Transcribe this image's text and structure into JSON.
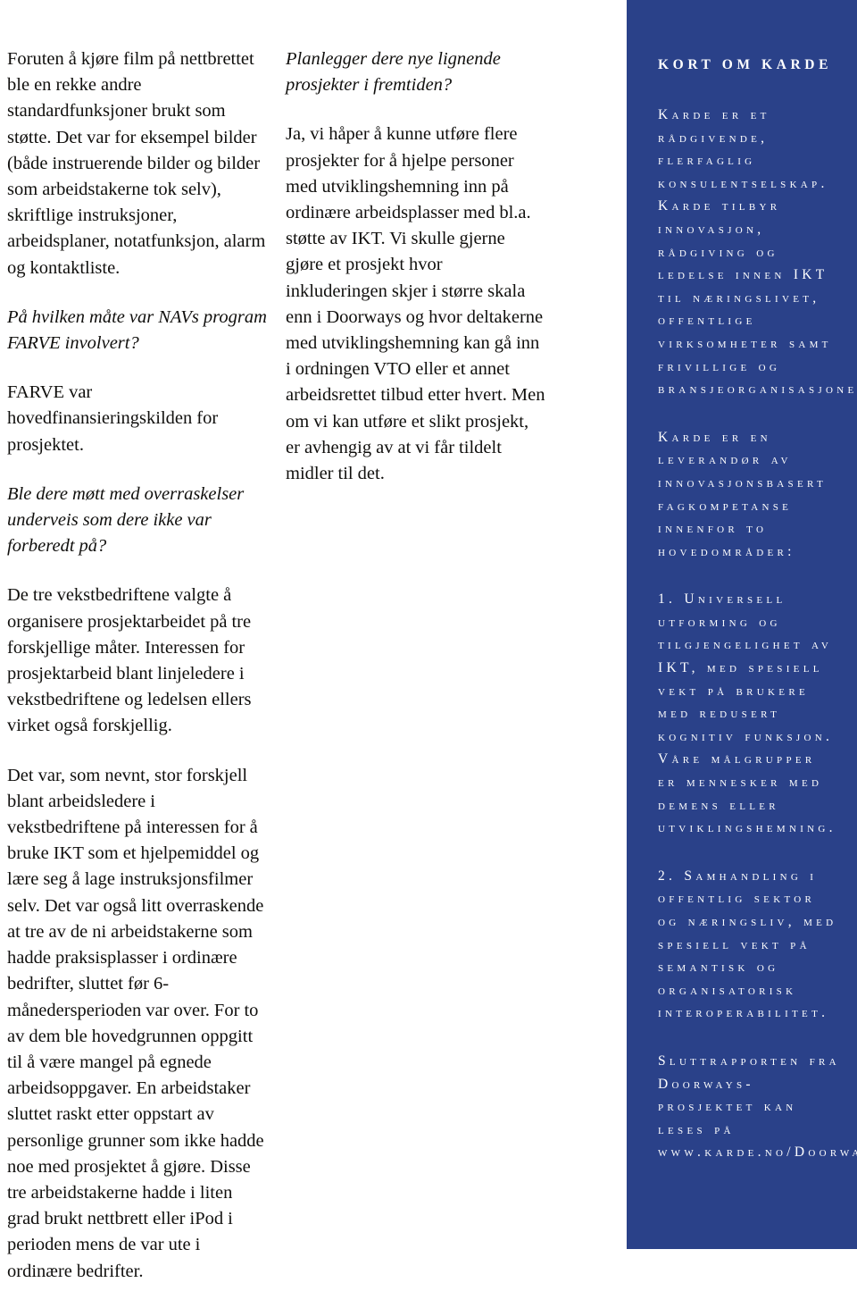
{
  "colors": {
    "sidebar_background": "#2a4189",
    "sidebar_text": "#ffffff",
    "body_text": "#100f0d",
    "page_background": "#ffffff"
  },
  "column_one": {
    "paragraphs": [
      {
        "style": "body",
        "text": "Foruten å kjøre film på nettbrettet ble en rekke andre standardfunksjoner brukt som støtte. Det var for eksempel bilder (både instruerende bilder og bilder som arbeidstakerne tok selv), skriftlige instruksjoner, arbeidsplaner, notatfunksjon, alarm og kontaktliste."
      },
      {
        "style": "question",
        "text": "På hvilken måte var NAVs program FARVE involvert?"
      },
      {
        "style": "body",
        "text": "FARVE var hovedfinansieringskilden for prosjektet."
      },
      {
        "style": "question",
        "text": "Ble dere møtt med overraskelser underveis som dere ikke var forberedt på?"
      },
      {
        "style": "body",
        "text": "De tre vekstbedriftene valgte å organisere prosjektarbeidet på tre forskjellige måter. Interessen for prosjektarbeid blant linjeledere i vekstbedriftene og ledelsen ellers virket også forskjellig."
      },
      {
        "style": "body",
        "text": "Det var, som nevnt, stor forskjell blant arbeidsledere i vekstbedriftene på interessen for å bruke IKT som et hjelpemiddel og lære seg å lage instruksjonsfilmer selv. Det var også litt overraskende at tre av de ni arbeidstakerne som hadde praksisplasser i ordinære bedrifter, sluttet før 6-månedersperioden var over. For to av dem ble hovedgrunnen oppgitt til å være mangel på egnede arbeidsoppgaver. En arbeidstaker sluttet raskt etter oppstart av personlige grunner som ikke hadde noe med prosjektet å gjøre. Disse tre arbeidstakerne hadde i liten grad brukt nettbrett eller iPod i perioden mens de var ute i ordinære bedrifter."
      }
    ]
  },
  "column_two": {
    "paragraphs": [
      {
        "style": "question",
        "text": "Planlegger dere nye lignende prosjekter i fremtiden?"
      },
      {
        "style": "body",
        "text": "Ja, vi håper å kunne utføre flere prosjekter for å hjelpe personer med utviklingshemning inn på ordinære arbeidsplasser med bl.a. støtte av IKT. Vi skulle gjerne gjøre et prosjekt hvor inkluderingen skjer i større skala enn i Doorways og hvor deltakerne med utviklingshemning kan gå inn i ordningen VTO eller et annet arbeidsrettet tilbud etter hvert. Men om vi kan utføre et slikt prosjekt, er avhengig av at vi får tildelt midler til det."
      }
    ]
  },
  "sidebar": {
    "heading": "Kort om Karde",
    "blocks": [
      {
        "text": "Karde er et rådgivende, flerfaglig konsulentselskap. Karde tilbyr innovasjon, rådgiving og ledelse innen IKT til næringslivet, offentlige virksomheter samt frivillige og bransjeorganisasjoner."
      },
      {
        "text": "Karde er en leverandør av innovasjonsbasert fagkompetanse innenfor to hovedområder:"
      },
      {
        "text": "1. Universell utforming og tilgjengelighet av IKT, med spesiell vekt på brukere med redusert kognitiv funksjon. Våre målgrupper er mennesker med demens eller utviklingshemning."
      },
      {
        "text": "2. Samhandling i offentlig sektor og næringsliv, med spesiell vekt på semantisk og organisatorisk interoperabilitet."
      },
      {
        "text": "Sluttrapporten fra Doorways-prosjektet kan leses på www.karde.no/Doorways_sluttrapport.pdf"
      }
    ]
  }
}
